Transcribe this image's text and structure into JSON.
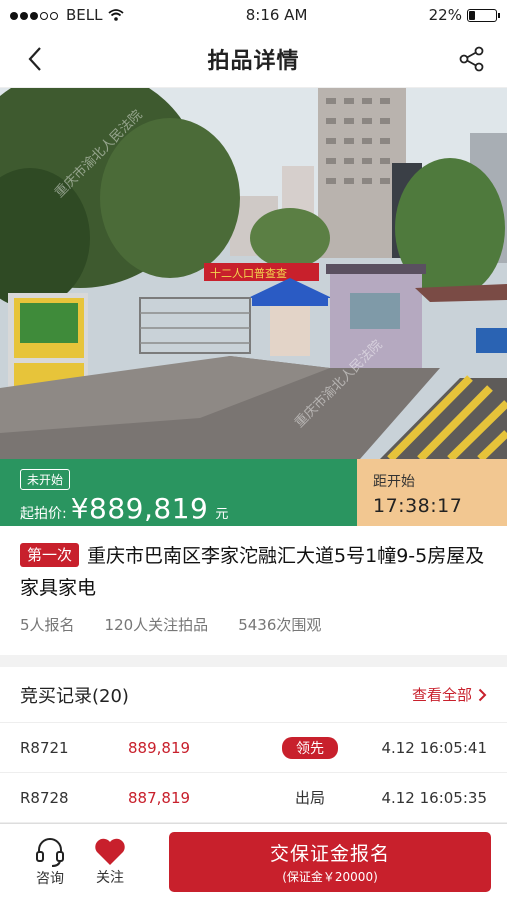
{
  "status": {
    "carrier": "BELL",
    "time": "8:16 AM",
    "battery": "22%"
  },
  "nav": {
    "title": "拍品详情"
  },
  "price": {
    "status_badge": "未开始",
    "label": "起拍价:",
    "amount": "¥889,819",
    "unit": "元",
    "countdown_label": "距开始",
    "countdown": "17:38:17"
  },
  "item": {
    "round_tag": "第一次",
    "title": "重庆市巴南区李家沱融汇大道5号1幢9-5房屋及家具家电",
    "signups": "5人报名",
    "followers": "120人关注拍品",
    "views": "5436次围观"
  },
  "records": {
    "heading": "竞买记录(20)",
    "view_all": "查看全部",
    "rows": [
      {
        "id": "R8721",
        "price": "889,819",
        "status": "领先",
        "time": "4.12 16:05:41"
      },
      {
        "id": "R8728",
        "price": "887,819",
        "status": "出局",
        "time": "4.12 16:05:35"
      }
    ]
  },
  "bottom": {
    "consult": "咨询",
    "follow": "关注",
    "cta_main": "交保证金报名",
    "cta_sub": "(保证金￥20000)"
  },
  "photo": {
    "banner": "十二人口普查查",
    "watermark": "重庆市渝北人民法院"
  },
  "colors": {
    "accent_red": "#c8202c",
    "price_green": "#2a9560",
    "countdown_bg": "#f2c791"
  }
}
